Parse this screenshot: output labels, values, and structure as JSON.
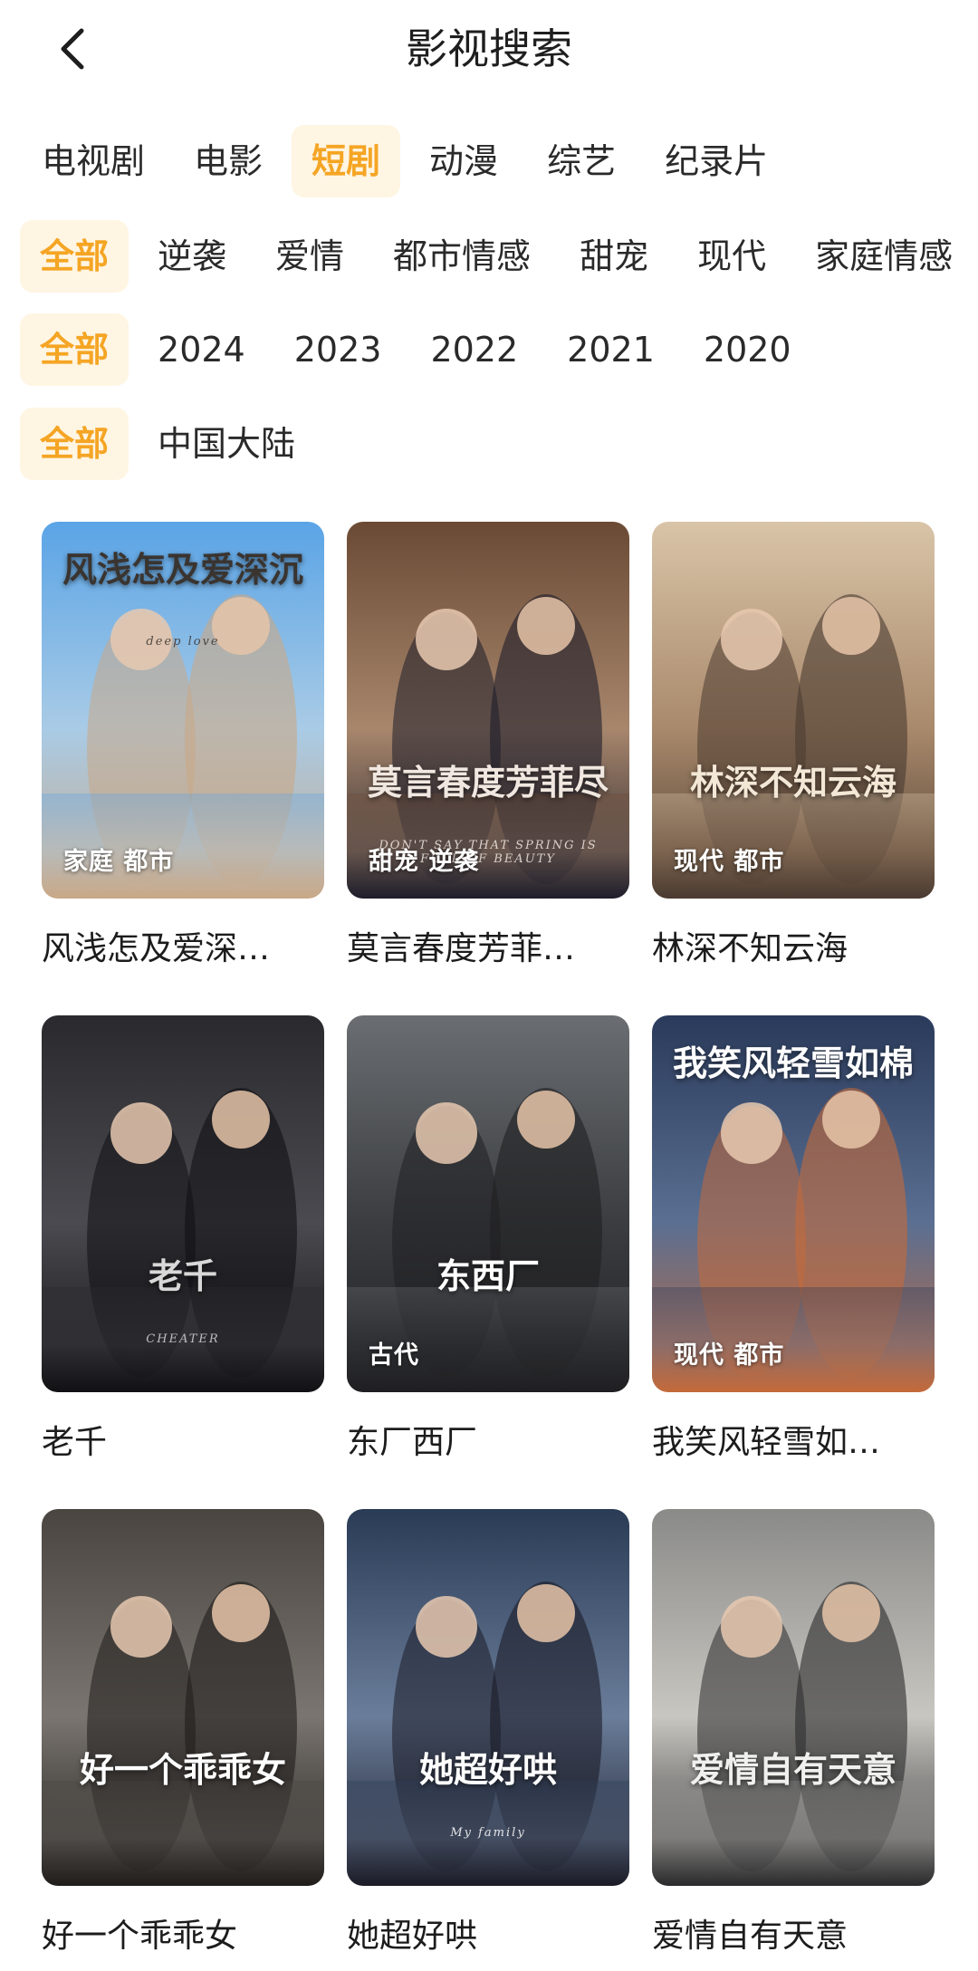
{
  "header": {
    "title": "影视搜索",
    "back_icon": "chevron-left-icon"
  },
  "categories": [
    {
      "label": "电视剧",
      "active": false
    },
    {
      "label": "电影",
      "active": false
    },
    {
      "label": "短剧",
      "active": true
    },
    {
      "label": "动漫",
      "active": false
    },
    {
      "label": "综艺",
      "active": false
    },
    {
      "label": "纪录片",
      "active": false
    }
  ],
  "genres": [
    {
      "label": "全部",
      "active": true
    },
    {
      "label": "逆袭",
      "active": false
    },
    {
      "label": "爱情",
      "active": false
    },
    {
      "label": "都市情感",
      "active": false
    },
    {
      "label": "甜宠",
      "active": false
    },
    {
      "label": "现代",
      "active": false
    },
    {
      "label": "家庭情感",
      "active": false
    }
  ],
  "years": [
    {
      "label": "全部",
      "active": true
    },
    {
      "label": "2024",
      "active": false
    },
    {
      "label": "2023",
      "active": false
    },
    {
      "label": "2022",
      "active": false
    },
    {
      "label": "2021",
      "active": false
    },
    {
      "label": "2020",
      "active": false
    }
  ],
  "regions": [
    {
      "label": "全部",
      "active": true
    },
    {
      "label": "中国大陆",
      "active": false
    }
  ],
  "colors": {
    "accent": "#f5a524",
    "accent_bg": "#fff5e3"
  },
  "items": [
    {
      "title": "风浅怎及爱深…",
      "tags": "家庭 都市",
      "poster_text": "风浅怎及爱深沉",
      "poster_sub": "deep love",
      "palette": [
        "#5aa4e6",
        "#a9cbe6",
        "#c9a887",
        "#3a3430"
      ]
    },
    {
      "title": "莫言春度芳菲…",
      "tags": "甜宠 逆袭",
      "poster_text": "莫言春度芳菲尽",
      "poster_sub": "DON'T SAY THAT SPRING IS FULL OF BEAUTY",
      "palette": [
        "#6b4a35",
        "#a7866c",
        "#1d1d2a",
        "#f0e8e0"
      ]
    },
    {
      "title": "林深不知云海",
      "tags": "现代 都市",
      "poster_text": "林深不知云海",
      "poster_sub": "",
      "palette": [
        "#d9c4a8",
        "#a9896b",
        "#4a3a30",
        "#f3e7d6"
      ]
    },
    {
      "title": "老千",
      "tags": "",
      "poster_text": "老千",
      "poster_sub": "CHEATER",
      "palette": [
        "#2a2a2e",
        "#4a4a50",
        "#111114",
        "#d8d8d8"
      ]
    },
    {
      "title": "东厂西厂",
      "tags": "古代",
      "poster_text": "东西厂",
      "poster_sub": "",
      "palette": [
        "#6a6e72",
        "#3b3d40",
        "#1f1f22",
        "#ffffff"
      ]
    },
    {
      "title": "我笑风轻雪如…",
      "tags": "现代 都市",
      "poster_text": "我笑风轻雪如棉",
      "poster_sub": "",
      "palette": [
        "#2a3a5a",
        "#5a6f92",
        "#c46a3a",
        "#ffffff"
      ]
    },
    {
      "title": "好一个乖乖女",
      "tags": "",
      "poster_text": "好一个乖乖女",
      "poster_sub": "",
      "palette": [
        "#4a4540",
        "#7a7570",
        "#1f1c1a",
        "#ffffff"
      ]
    },
    {
      "title": "她超好哄",
      "tags": "",
      "poster_text": "她超好哄",
      "poster_sub": "My family",
      "palette": [
        "#2a3b55",
        "#6a7d9a",
        "#1b1b26",
        "#ffffff"
      ]
    },
    {
      "title": "爱情自有天意",
      "tags": "",
      "poster_text": "爱情自有天意",
      "poster_sub": "",
      "palette": [
        "#8a8a88",
        "#c8c6c0",
        "#2a2a2c",
        "#f0f0ee"
      ]
    }
  ]
}
